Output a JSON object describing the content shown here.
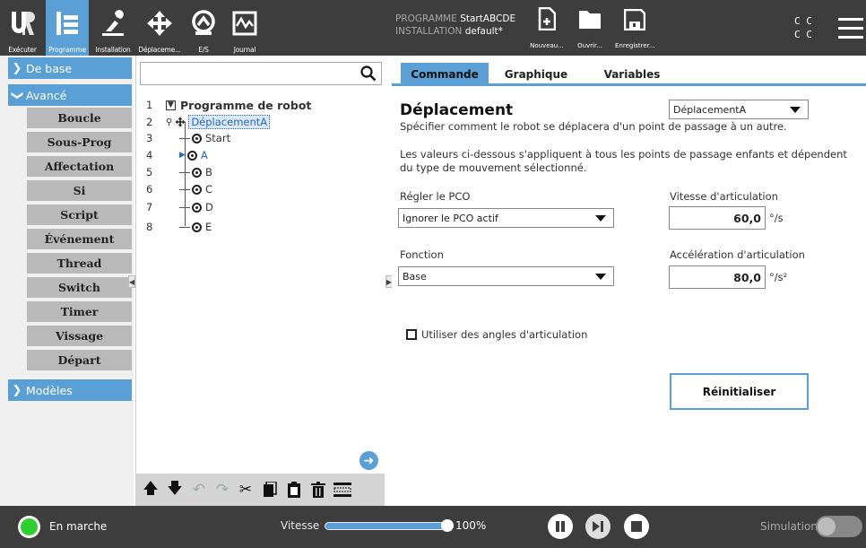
{
  "app": {
    "accent": "#5aa0d6",
    "dark": "#3d3d3d"
  },
  "topbar": {
    "tabs": [
      {
        "label": "Exécuter",
        "icon": "ur-logo-icon"
      },
      {
        "label": "Programme",
        "icon": "program-icon",
        "active": true
      },
      {
        "label": "Installation",
        "icon": "installation-icon"
      },
      {
        "label": "Déplaceme...",
        "icon": "move-icon"
      },
      {
        "label": "E/S",
        "icon": "io-icon"
      },
      {
        "label": "Journal",
        "icon": "log-icon"
      }
    ],
    "program_label": "PROGRAMME",
    "program_value": "StartABCDE",
    "installation_label": "INSTALLATION",
    "installation_value": "default*",
    "file_buttons": [
      {
        "label": "Nouveau...",
        "icon": "new-file-icon"
      },
      {
        "label": "Ouvrir...",
        "icon": "folder-icon"
      },
      {
        "label": "Enregistrer...",
        "icon": "save-icon"
      }
    ],
    "cc_line1": "C C",
    "cc_line2": "C C"
  },
  "sidebar": {
    "categories": [
      {
        "label": "De base",
        "expanded": false
      },
      {
        "label": "Avancé",
        "expanded": true
      },
      {
        "label": "Modèles",
        "expanded": false
      }
    ],
    "items": [
      "Boucle",
      "Sous-Prog",
      "Affectation",
      "Si",
      "Script",
      "Événement",
      "Thread",
      "Switch",
      "Timer",
      "Vissage",
      "Départ"
    ]
  },
  "tree": {
    "rows": [
      {
        "num": "1",
        "label": "Programme de robot"
      },
      {
        "num": "2",
        "label": "DéplacementA"
      },
      {
        "num": "3",
        "label": "Start"
      },
      {
        "num": "4",
        "label": "A"
      },
      {
        "num": "5",
        "label": "B"
      },
      {
        "num": "6",
        "label": "C"
      },
      {
        "num": "7",
        "label": "D"
      },
      {
        "num": "8",
        "label": "E"
      }
    ]
  },
  "tabs": [
    "Commande",
    "Graphique",
    "Variables"
  ],
  "command": {
    "title": "Déplacement",
    "subtitle": "Spécifier comment le robot se déplacera d'un point de passage à un autre.",
    "desc_line1": "Les valeurs ci-dessous s'appliquent à tous les points de passage enfants et dépendent",
    "desc_line2": "du type de mouvement sélectionné.",
    "move_type": "DéplacementA",
    "tcp_label": "Régler le PCO",
    "tcp_value": "Ignorer le PCO actif",
    "feature_label": "Fonction",
    "feature_value": "Base",
    "joint_speed_label": "Vitesse d'articulation",
    "joint_speed_value": "60,0",
    "joint_speed_unit": "°/s",
    "joint_accel_label": "Accélération d'articulation",
    "joint_accel_value": "80,0",
    "joint_accel_unit": "°/s²",
    "use_joint_angles_label": "Utiliser des angles d'articulation",
    "use_joint_angles_checked": false,
    "reset_label": "Réinitialiser"
  },
  "bottombar": {
    "status": "En marche",
    "speed_label": "Vitesse",
    "speed_value": "100%",
    "speed_fraction": 1.0,
    "simulation_label": "Simulation"
  }
}
